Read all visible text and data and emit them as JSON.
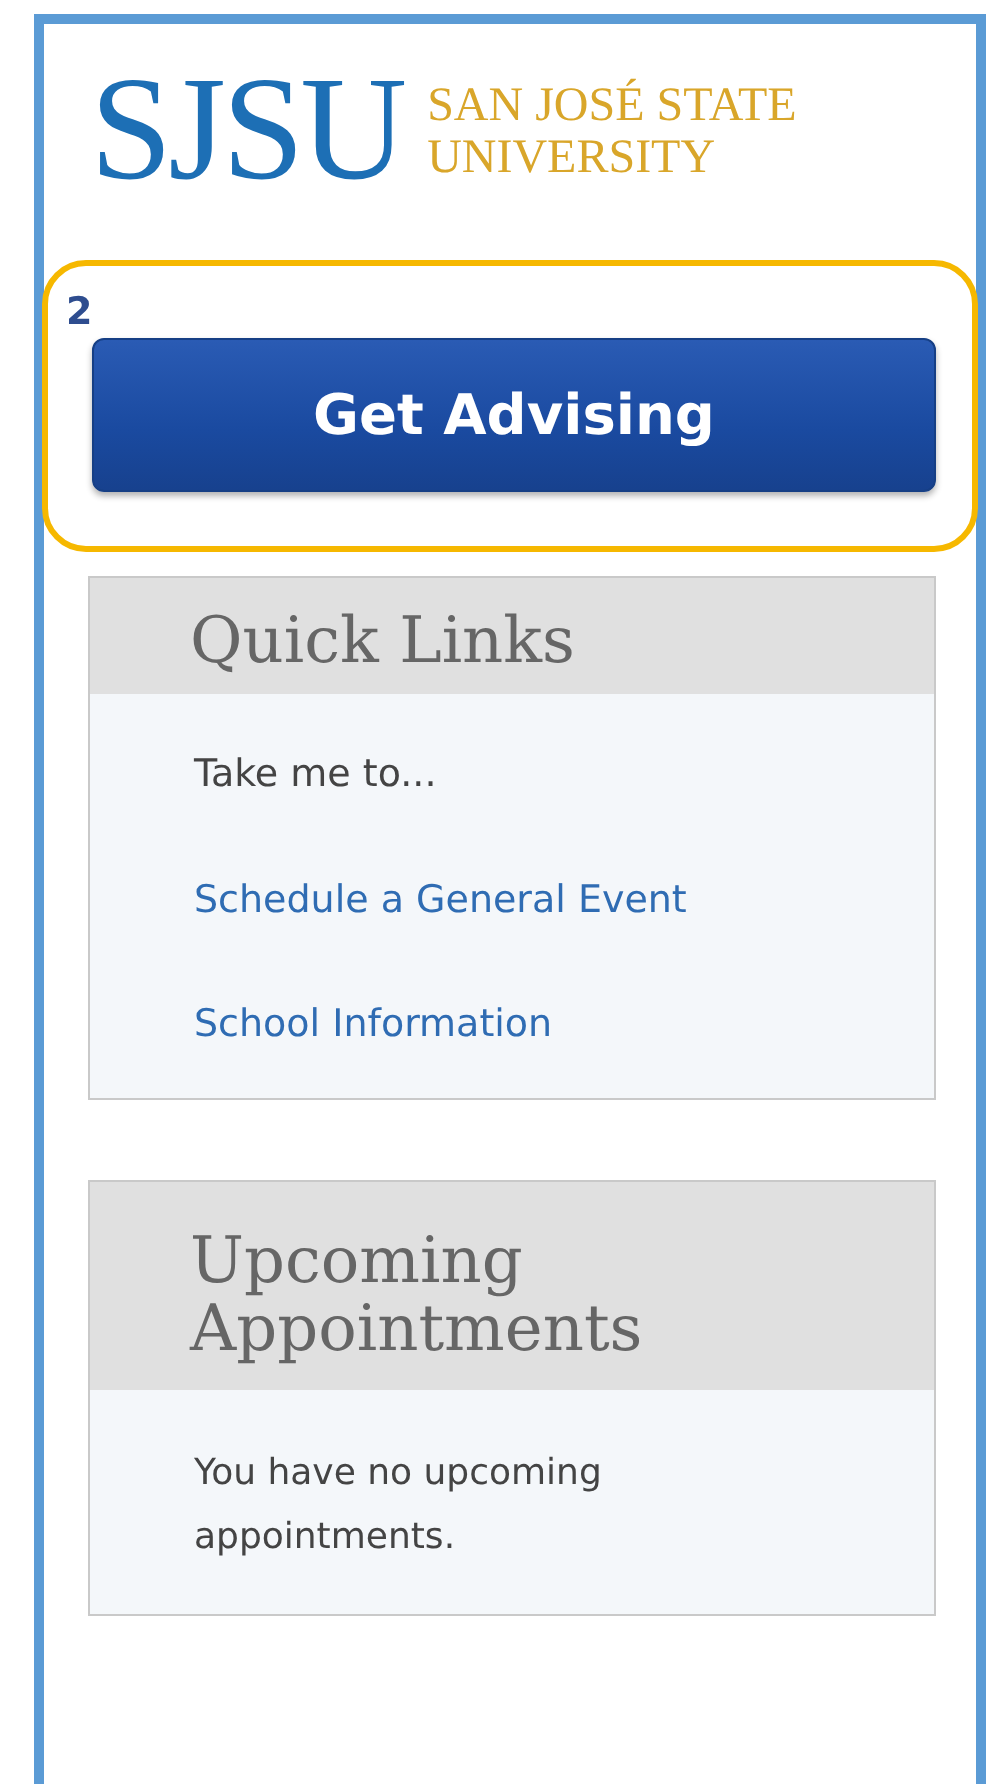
{
  "logo": {
    "mark": "SJSU",
    "name_lines": [
      "SAN JOSÉ STATE",
      "UNIVERSITY"
    ]
  },
  "callout": {
    "number": "2",
    "button": "Get Advising"
  },
  "quick_links": {
    "title": "Quick Links",
    "intro": "Take me to...",
    "links": [
      "Schedule a General Event",
      "School Information"
    ]
  },
  "upcoming": {
    "title_lines": [
      "Upcoming",
      "Appointments"
    ],
    "message": "You have no upcoming appointments."
  }
}
